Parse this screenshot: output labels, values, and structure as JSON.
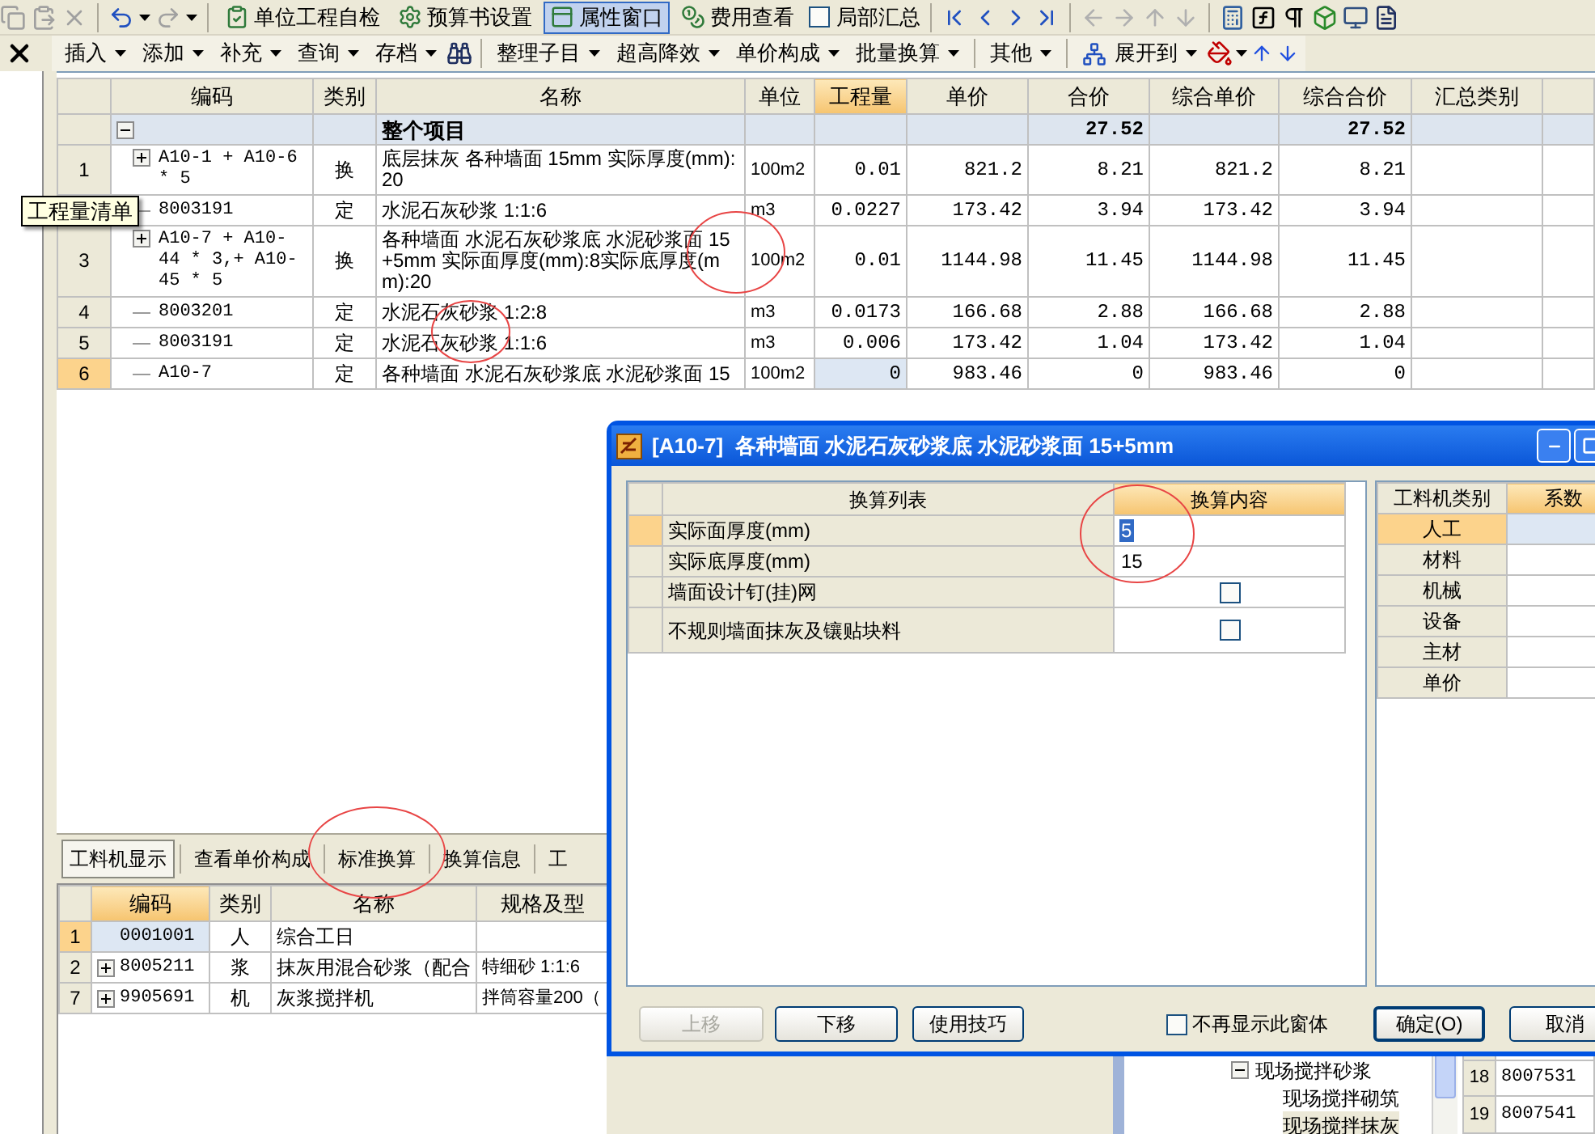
{
  "toolbar": {
    "buttons": [
      {
        "label": "单位工程自检",
        "selected": false
      },
      {
        "label": "预算书设置",
        "selected": false
      },
      {
        "label": "属性窗口",
        "selected": true
      },
      {
        "label": "费用查看",
        "selected": false
      }
    ],
    "checkbox": {
      "label": "局部汇总",
      "checked": false
    }
  },
  "menu_toolbar": {
    "groups": [
      {
        "items": [
          {
            "label": "插入",
            "dropdown": true
          },
          {
            "label": "添加",
            "dropdown": true
          },
          {
            "label": "补充",
            "dropdown": true
          },
          {
            "label": "查询",
            "dropdown": true
          },
          {
            "label": "存档",
            "dropdown": true
          }
        ]
      },
      {
        "items": [
          {
            "label": "整理子目",
            "dropdown": true
          },
          {
            "label": "超高降效",
            "dropdown": true
          },
          {
            "label": "单价构成",
            "dropdown": true
          },
          {
            "label": "批量换算",
            "dropdown": true
          }
        ]
      },
      {
        "items": [
          {
            "label": "其他",
            "dropdown": true
          }
        ]
      },
      {
        "items": [
          {
            "label": "展开到",
            "dropdown": true
          }
        ]
      }
    ]
  },
  "tooltip": "工程量清单",
  "table": {
    "columns": [
      {
        "label": "编码",
        "selected": false
      },
      {
        "label": "类别",
        "selected": false
      },
      {
        "label": "名称",
        "selected": false
      },
      {
        "label": "单位",
        "selected": false
      },
      {
        "label": "工程量",
        "selected": true
      },
      {
        "label": "单价",
        "selected": false
      },
      {
        "label": "合价",
        "selected": false
      },
      {
        "label": "综合单价",
        "selected": false
      },
      {
        "label": "综合合价",
        "selected": false
      },
      {
        "label": "汇总类别",
        "selected": false
      }
    ],
    "summary": {
      "name": "整个项目",
      "total": "27.52",
      "comp_total": "27.52",
      "expanded": true
    },
    "rows": [
      {
        "num": "1",
        "expanded": false,
        "code": "A10-1 + A10-6 * 5",
        "type": "换",
        "name": "底层抹灰 各种墙面 15mm 实际厚度(mm):20",
        "unit": "100m2",
        "qty": "0.01",
        "price": "821.2",
        "total": "8.21",
        "comp_price": "821.2",
        "comp_total": "8.21",
        "selected": false
      },
      {
        "code": "8003191",
        "type": "定",
        "name": "水泥石灰砂浆 1:1:6",
        "unit": "m3",
        "qty": "0.0227",
        "price": "173.42",
        "total": "3.94",
        "comp_price": "173.42",
        "comp_total": "3.94"
      },
      {
        "num": "3",
        "expanded": false,
        "code": "A10-7 + A10-44 * 3,+ A10-45 * 5",
        "type": "换",
        "name": "各种墙面 水泥石灰砂浆底 水泥砂浆面 15+5mm 实际面厚度(mm):8实际底厚度(mm):20",
        "unit": "100m2",
        "qty": "0.01",
        "price": "1144.98",
        "total": "11.45",
        "comp_price": "1144.98",
        "comp_total": "11.45",
        "selected": false
      },
      {
        "num": "4",
        "code": "8003201",
        "type": "定",
        "name": "水泥石灰砂浆 1:2:8",
        "unit": "m3",
        "qty": "0.0173",
        "price": "166.68",
        "total": "2.88",
        "comp_price": "166.68",
        "comp_total": "2.88",
        "selected": false
      },
      {
        "num": "5",
        "code": "8003191",
        "type": "定",
        "name": "水泥石灰砂浆 1:1:6",
        "unit": "m3",
        "qty": "0.006",
        "price": "173.42",
        "total": "1.04",
        "comp_price": "173.42",
        "comp_total": "1.04",
        "selected": false
      },
      {
        "num": "6",
        "code": "A10-7",
        "type": "定",
        "name": "各种墙面 水泥石灰砂浆底 水泥砂浆面 15",
        "unit": "100m2",
        "qty": "0",
        "price": "983.46",
        "total": "0",
        "comp_price": "983.46",
        "comp_total": "0",
        "selected": true
      }
    ]
  },
  "bottom_panel": {
    "tabs": [
      {
        "label": "工料机显示",
        "selected": true
      },
      {
        "label": "查看单价构成",
        "selected": false
      },
      {
        "label": "标准换算",
        "selected": false
      },
      {
        "label": "换算信息",
        "selected": false
      },
      {
        "label": "工",
        "selected": false
      }
    ],
    "columns": [
      {
        "label": "编码",
        "selected": true
      },
      {
        "label": "类别",
        "selected": false
      },
      {
        "label": "名称",
        "selected": false
      },
      {
        "label": "规格及型",
        "selected": false
      }
    ],
    "rows": [
      {
        "num": "1",
        "code": "0001001",
        "type": "人",
        "name": "综合工日",
        "selected": true
      },
      {
        "num": "2",
        "expanded": false,
        "code": "8005211",
        "type": "浆",
        "name": "抹灰用混合砂浆（配合",
        "spec": "特细砂 1:1:6",
        "selected": false
      },
      {
        "num": "7",
        "expanded": false,
        "code": "9905691",
        "type": "机",
        "name": "灰浆搅拌机",
        "spec": "拌筒容量200（",
        "selected": false
      }
    ]
  },
  "dialog": {
    "title": "[A10-7]  各种墙面 水泥石灰砂浆底 水泥砂浆面 15+5mm",
    "columns": [
      {
        "label": "换算列表",
        "selected": false
      },
      {
        "label": "换算内容",
        "selected": true
      }
    ],
    "rows": [
      {
        "kind": "text",
        "label": "实际面厚度(mm)",
        "value": "5",
        "selected": true
      },
      {
        "kind": "text",
        "label": "实际底厚度(mm)",
        "value": "15",
        "selected": false
      },
      {
        "kind": "checkbox",
        "label": "墙面设计钉(挂)网",
        "checked": false,
        "selected": false
      },
      {
        "kind": "checkbox",
        "label": "不规则墙面抹灰及镶贴块料",
        "checked": false,
        "selected": false
      }
    ],
    "coef_columns": [
      {
        "label": "工料机类别",
        "selected": false
      },
      {
        "label": "系数",
        "selected": true
      }
    ],
    "coef_rows": [
      {
        "label": "人工",
        "selected": true
      },
      {
        "label": "材料",
        "selected": false
      },
      {
        "label": "机械",
        "selected": false
      },
      {
        "label": "设备",
        "selected": false
      },
      {
        "label": "主材",
        "selected": false
      },
      {
        "label": "单价",
        "selected": false
      }
    ],
    "buttons": [
      {
        "label": "上移",
        "disabled": true
      },
      {
        "label": "下移",
        "disabled": false
      },
      {
        "label": "使用技巧",
        "disabled": false
      }
    ],
    "dont_show": {
      "label": "不再显示此窗体",
      "checked": false
    },
    "confirm_buttons": [
      {
        "label": "确定(O)"
      },
      {
        "label": "取消"
      }
    ]
  },
  "side_tree": {
    "items": [
      {
        "label": "现场搅拌砂浆",
        "expanded": true,
        "selected": false,
        "children": [
          {
            "label": "现场搅拌砌筑",
            "selected": false
          },
          {
            "label": "现场搅拌抹灰",
            "selected": true
          }
        ]
      }
    ]
  },
  "side_table": {
    "rows": [
      {
        "num": "18",
        "code": "8007531"
      },
      {
        "num": "19",
        "code": "8007541"
      }
    ]
  }
}
